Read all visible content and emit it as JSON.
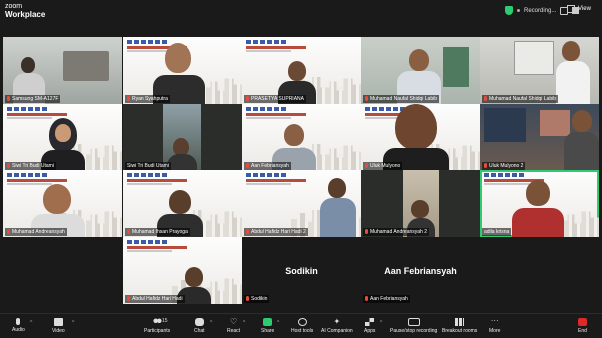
{
  "app": {
    "brand_line1": "zoom",
    "brand_line2": "Workplace"
  },
  "topbar": {
    "recording_label": "Recording...",
    "view_label": "View"
  },
  "tiles": [
    {
      "name": "Samsung SM-A127F"
    },
    {
      "name": "Ryan Syahputra"
    },
    {
      "name": "PRASETYA SUPRIANA"
    },
    {
      "name": "Muhamad Naufal Shidqi Labib"
    },
    {
      "name": "Muhamad Naufal Shidqi Labib"
    },
    {
      "name": "Siwi Tri Budi Utami"
    },
    {
      "name": "Siwi Tri Budi Utami"
    },
    {
      "name": "Aan Febriansyah"
    },
    {
      "name": "Uluk Mulyono"
    },
    {
      "name": "Uluk Mulyono 2"
    },
    {
      "name": "Muhamad Andreansyah"
    },
    {
      "name": "Muhamad Ihsan Prayoga"
    },
    {
      "name": "Abdul Hafidz Hari Hadi 2"
    },
    {
      "name": "Muhamad Andreansyah 2"
    },
    {
      "name": "adila krisna"
    },
    {
      "name": "Abdul Hafidz Hari Hadi"
    },
    {
      "name": "Sodikin",
      "display": "Sodikin"
    },
    {
      "name": "Aan Febriansyah",
      "display": "Aan Febriansyah"
    }
  ],
  "toolbar": {
    "audio": "Audio",
    "video": "Video",
    "participants": "Participants",
    "participants_count": "15",
    "chat": "Chat",
    "react": "React",
    "share": "Share",
    "host_tools": "Host tools",
    "ai_companion": "AI Companion",
    "apps": "Apps",
    "pause_recording": "Pause/stop recording",
    "breakout_rooms": "Breakout rooms",
    "more": "More",
    "end": "End"
  }
}
